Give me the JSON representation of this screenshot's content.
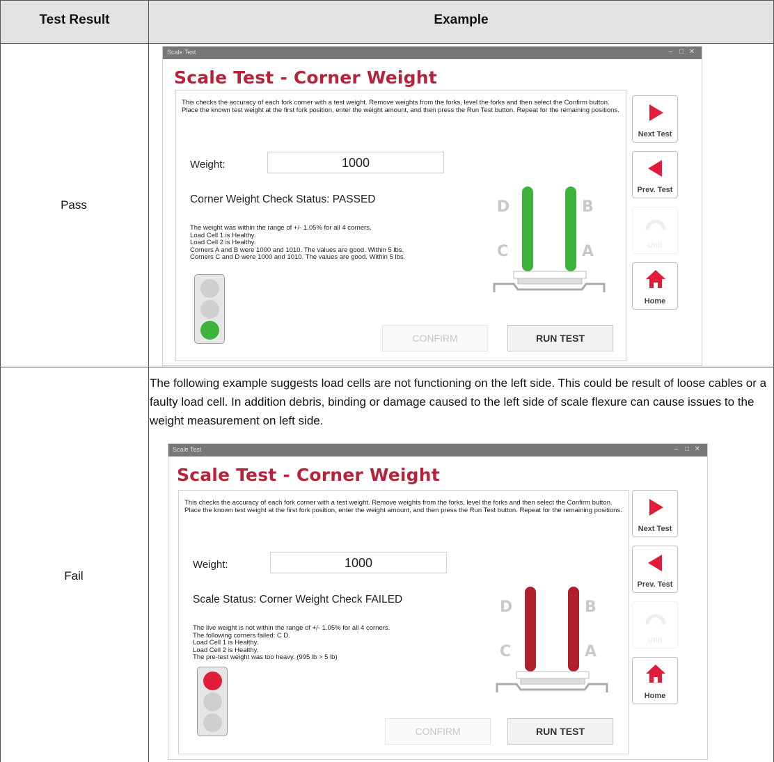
{
  "table": {
    "header_result": "Test Result",
    "header_example": "Example",
    "pass_label": "Pass",
    "fail_label": "Fail",
    "fail_description": "The following example suggests load cells are not functioning on the left side. This could be result of loose cables or a faulty load cell. In addition debris, binding or damage caused to the left side of scale flexure can cause issues to the weight measurement on left side."
  },
  "colors": {
    "title_red": "#b5243a",
    "fork_green": "#3db33d",
    "fork_red": "#b21f2e",
    "light_green": "#3db33d",
    "light_red": "#e21d3a",
    "light_off": "#cfcfcf"
  },
  "pass_window": {
    "window_title": "Scale Test",
    "heading": "Scale Test - Corner Weight",
    "instructions": "This checks the accuracy of each fork corner with a test weight. Remove weights from the forks, level the forks and then select the Confirm button. Place the known test weight at the first fork position, enter the weight amount, and then press the Run Test button. Repeat for the remaining positions.",
    "weight_label": "Weight:",
    "weight_value": "1000",
    "status": "Corner Weight Check Status: PASSED",
    "details": [
      "The weight was within the range of +/- 1.05% for all 4 corners.",
      "Load Cell 1 is Healthy.",
      "Load Cell 2 is Healthy.",
      "Corners A and B were 1000 and 1010. The values are good. Within 5 lbs.",
      "Corners C and D were 1000 and 1010. The values are good. Within 5 lbs."
    ],
    "confirm_label": "CONFIRM",
    "run_test_label": "RUN TEST",
    "next_test_label": "Next Test",
    "prev_test_label": "Prev. Test",
    "hidden_label": "Unit",
    "home_label": "Home",
    "corners": {
      "d": "D",
      "b": "B",
      "c": "C",
      "a": "A"
    },
    "traffic_light": "green",
    "fork_state": "green"
  },
  "fail_window": {
    "window_title": "Scale Test",
    "heading": "Scale Test - Corner Weight",
    "instructions": "This checks the accuracy of each fork corner with a test weight. Remove weights from the forks, level the forks and then select the Confirm button. Place the known test weight at the first fork position, enter the weight amount, and then press the Run Test button. Repeat for the remaining positions.",
    "weight_label": "Weight:",
    "weight_value": "1000",
    "status": "Scale Status: Corner Weight Check FAILED",
    "details": [
      "The live weight is not within the range of +/- 1.05% for all 4 corners.",
      "The following corners failed:  C D.",
      "Load Cell 1 is Healthy.",
      "Load Cell 2 is Healthy.",
      "The pre-test weight was too heavy. (995 lb > 5 lb)"
    ],
    "confirm_label": "CONFIRM",
    "run_test_label": "RUN TEST",
    "next_test_label": "Next Test",
    "prev_test_label": "Prev. Test",
    "hidden_label": "Unit",
    "home_label": "Home",
    "corners": {
      "d": "D",
      "b": "B",
      "c": "C",
      "a": "A"
    },
    "traffic_light": "red",
    "fork_state": "red"
  }
}
